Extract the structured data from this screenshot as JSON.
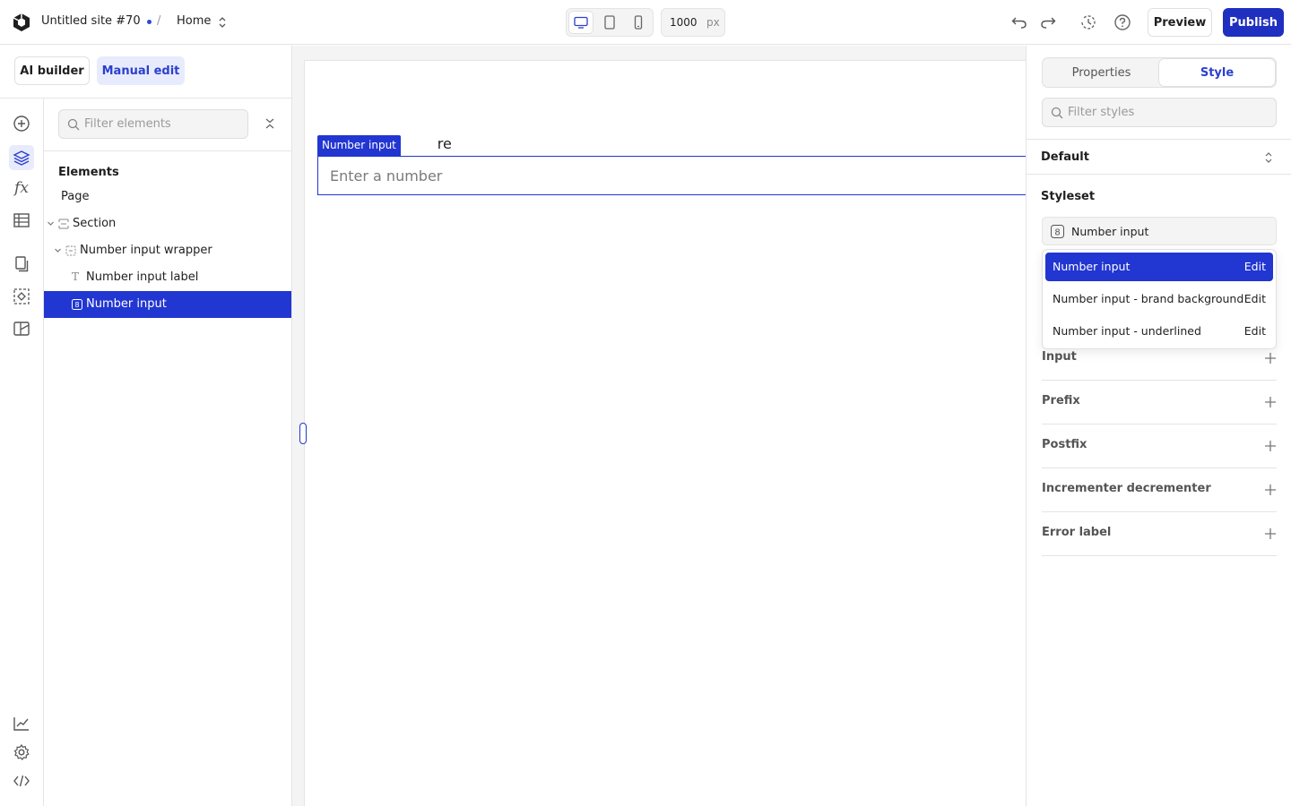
{
  "topbar": {
    "site_name": "Untitled site #70",
    "separator": "/",
    "page": "Home",
    "width_value": "1000",
    "width_unit": "px",
    "preview_label": "Preview",
    "publish_label": "Publish",
    "accent_color": "#1f2fbf"
  },
  "modes": {
    "ai_label": "AI builder",
    "manual_label": "Manual edit",
    "active": "Manual edit"
  },
  "rail": {
    "icons": [
      "add-icon",
      "layers-icon",
      "function-icon",
      "table-icon",
      "pages-icon",
      "components-icon",
      "assets-icon",
      "analytics-icon",
      "settings-icon",
      "code-icon"
    ],
    "active": "layers-icon"
  },
  "layers": {
    "filter_placeholder": "Filter elements",
    "title": "Elements",
    "tree": [
      {
        "label": "Page"
      },
      {
        "label": "Section"
      },
      {
        "label": "Number input wrapper"
      },
      {
        "label": "Number input label"
      },
      {
        "label": "Number input",
        "selected": true
      }
    ]
  },
  "canvas": {
    "label_tail": "re",
    "badge": "Number input",
    "input_placeholder": "Enter a number"
  },
  "style_panel": {
    "tabs": [
      "Properties",
      "Style"
    ],
    "active_tab": "Style",
    "filter_placeholder": "Filter styles",
    "state": "Default",
    "styleset_title": "Styleset",
    "styleset_selected": "Number input",
    "styleset_options": [
      {
        "label": "Number input",
        "action": "Edit",
        "active": true
      },
      {
        "label": "Number input - brand background",
        "action": "Edit"
      },
      {
        "label": "Number input - underlined",
        "action": "Edit"
      }
    ],
    "sections": [
      "Input",
      "Prefix",
      "Postfix",
      "Incrementer decrementer",
      "Error label"
    ]
  }
}
